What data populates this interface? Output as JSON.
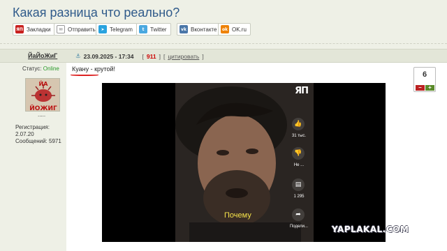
{
  "page": {
    "title": "Какая разница что реально?"
  },
  "share": [
    {
      "label": "Закладки",
      "icon": "yap-icon",
      "color": "#c8201e",
      "glyph": "ЯП"
    },
    {
      "label": "Отправить",
      "icon": "mail-icon",
      "color": "#8a8a8a",
      "glyph": "✉"
    },
    {
      "label": "Telegram",
      "icon": "telegram-icon",
      "color": "#2aa3df",
      "glyph": "➤"
    },
    {
      "label": "Twitter",
      "icon": "twitter-icon",
      "color": "#4aa8e0",
      "glyph": "t"
    },
    {
      "label": "Вконтакте",
      "icon": "vk-icon",
      "color": "#4a76a8",
      "glyph": "vk"
    },
    {
      "label": "OK.ru",
      "icon": "ok-icon",
      "color": "#ee8208",
      "glyph": "ok"
    }
  ],
  "post": {
    "author": "ЙаЙоЖиГ",
    "anchor_glyph": "⚓",
    "date": "23.09.2025 - 17:34",
    "bracket_open": "[",
    "bracket_close": "]",
    "post_number": "911",
    "quote_link": "цитировать",
    "message_name": "Куану",
    "message_rest": " - крутой!",
    "rating": "6",
    "rating_minus": "–",
    "rating_plus": "+"
  },
  "user": {
    "status_label": "Статус:",
    "status_value": "Online",
    "dots": ".....",
    "reg_label": "Регистрация:",
    "reg_date": "2.07.20",
    "messages_label": "Сообщений:",
    "messages_count": "5971",
    "avatar_text_top": "ЙА",
    "avatar_text_bottom": "ЙОЖИГ"
  },
  "video": {
    "logo": "ЯП",
    "likes": "31 тыс.",
    "dislike": "Не ...",
    "comments": "1 295",
    "share_label": "Подели...",
    "subtitle": "Почему"
  },
  "watermark": "YAPLAKAL.COM",
  "colors": {
    "title": "#2f5a8a",
    "online": "#2a9a2a",
    "post_number": "#cc0000",
    "subtitle": "#f5e24a"
  }
}
